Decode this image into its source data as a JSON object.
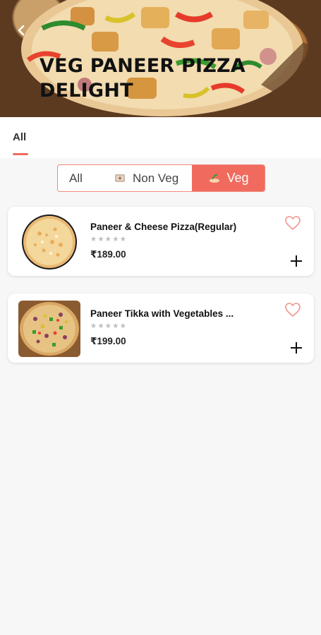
{
  "header": {
    "title": "VEG PANEER PIZZA DELIGHT",
    "back_icon": "chevron-left-icon"
  },
  "tabs": [
    {
      "label": "All",
      "active": true
    }
  ],
  "filter": {
    "options": [
      {
        "label": "All",
        "selected": false
      },
      {
        "label": "Non Veg",
        "selected": false,
        "icon": "non-veg-icon"
      },
      {
        "label": "Veg",
        "selected": true,
        "icon": "veg-icon"
      }
    ],
    "accent_color": "#f06b5e"
  },
  "items": [
    {
      "name": "Paneer & Cheese Pizza(Regular)",
      "stars": "★★★★★",
      "price": "₹189.00",
      "favorite_icon": "heart-outline-icon",
      "add_icon": "plus-icon"
    },
    {
      "name": "Paneer Tikka with Vegetables ...",
      "stars": "★★★★★",
      "price": "₹199.00",
      "favorite_icon": "heart-outline-icon",
      "add_icon": "plus-icon"
    }
  ]
}
